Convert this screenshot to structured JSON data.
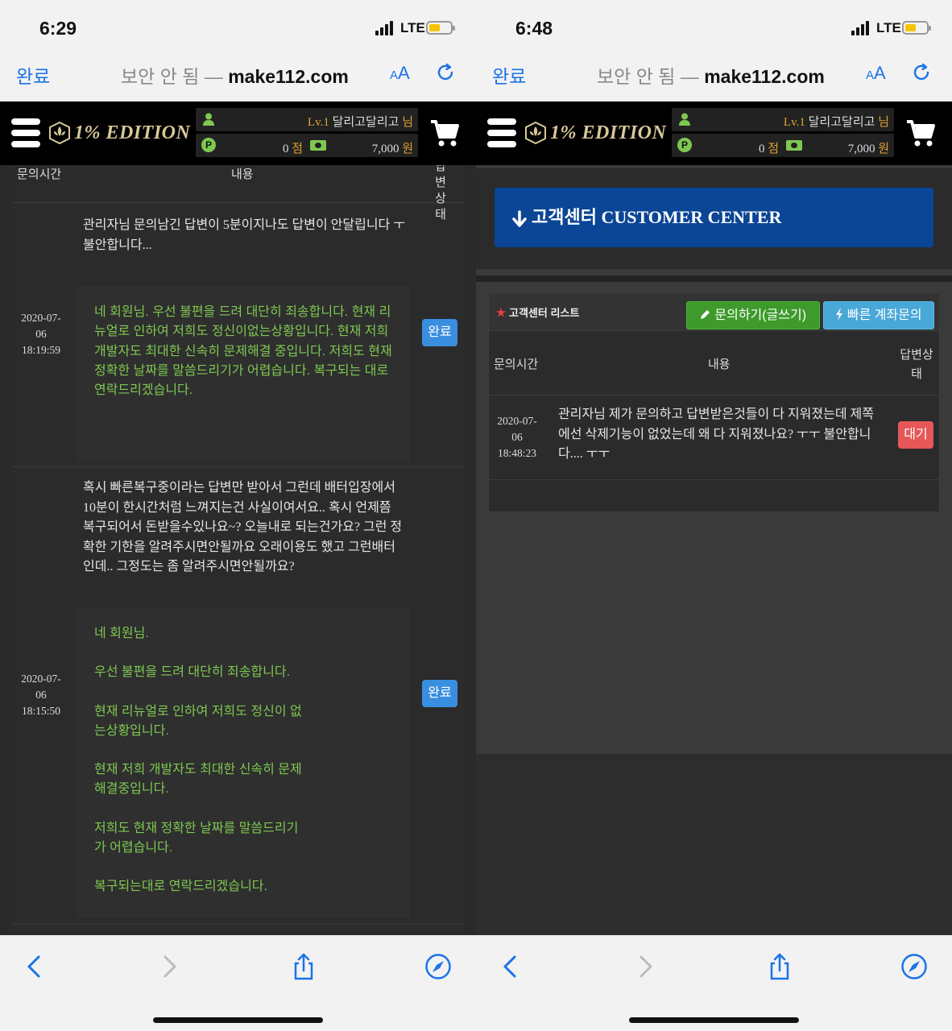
{
  "left": {
    "status": {
      "time": "6:29",
      "network": "LTE"
    },
    "browser": {
      "done": "완료",
      "insecure": "보안 안 됨",
      "separator": " — ",
      "host": "make112.com",
      "aa_big": "A",
      "aa_small": "A"
    },
    "header": {
      "logo_text": "1% EDITION",
      "level": "Lv.1",
      "username": "달리고달리고",
      "honorific": "님",
      "points_badge": "P",
      "points": "0",
      "points_unit": "점",
      "money": "7,000",
      "money_unit": "원"
    },
    "table": {
      "columns": [
        "문의시간",
        "내용",
        "답변상태"
      ],
      "rows": [
        {
          "question": "관리자님 문의남긴 답변이 5분이지나도 답변이 안달립니다 ㅜ 불안합니다...",
          "date": "2020-07-",
          "day": "06",
          "time": "18:19:59",
          "reply": "네 회원님. 우선 불편을 드려 대단히 죄송합니다. 현재 리뉴얼로 인하여 저희도 정신이없는상황입니다. 현재 저희 개발자도 최대한 신속히 문제해결 중입니다. 저희도 현재 정확한 날짜를 말씀드리기가 어렵습니다. 복구되는 대로 연락드리겠습니다.",
          "status": "완료"
        },
        {
          "question": "혹시 빠른복구중이라는 답변만 받아서 그런데 배터입장에서 10분이 한시간처럼 느껴지는건 사실이여서요.. 혹시 언제쯤 복구되어서 돈받을수있나요~? 오늘내로 되는건가요? 그런 정확한 기한을 알려주시면안될까요 오래이용도 했고 그런배터인데.. 그정도는 좀 알려주시면안될까요?",
          "date": "2020-07-",
          "day": "06",
          "time": "18:15:50",
          "reply_lines": [
            "네 회원님.",
            "우선 불편을 드려 대단히 죄송합니다.",
            "현재 리뉴얼로 인하여 저희도 정신이 없는상황입니다.",
            "현재 저희 개발자도 최대한 신속히 문제해결중입니다.",
            "저희도 현재 정확한 날짜를 말씀드리기가 어렵습니다.",
            "복구되는대로 연락드리겠습니다."
          ],
          "status": "완료"
        }
      ]
    }
  },
  "right": {
    "status": {
      "time": "6:48",
      "network": "LTE"
    },
    "browser": {
      "done": "완료",
      "insecure": "보안 안 됨",
      "separator": " — ",
      "host": "make112.com",
      "aa_big": "A",
      "aa_small": "A"
    },
    "header": {
      "logo_text": "1% EDITION",
      "level": "Lv.1",
      "username": "달리고달리고",
      "honorific": "님",
      "points_badge": "P",
      "points": "0",
      "points_unit": "점",
      "money": "7,000",
      "money_unit": "원"
    },
    "banner": "고객센터 CUSTOMER CENTER",
    "panel": {
      "title": "고객센터 리스트",
      "write_button": "문의하기(글쓰기)",
      "fast_button": "빠른 계좌문의",
      "columns": [
        "문의시간",
        "내용",
        "답변상태"
      ],
      "rows": [
        {
          "date": "2020-07-",
          "day": "06",
          "time": "18:48:23",
          "question": "관리자님 제가 문의하고 답변받은것들이 다 지워졌는데 제쪽에선 삭제기능이 없었는데 왜 다 지워졌나요? ㅜㅜ 불안합니다.... ㅜㅜ",
          "status": "대기"
        }
      ]
    }
  },
  "colors": {
    "accent": "#1a73e8",
    "reply_green": "#7ec850",
    "banner_blue": "#0a4596",
    "status_done": "#3a8ee0",
    "status_wait": "#e65858"
  }
}
